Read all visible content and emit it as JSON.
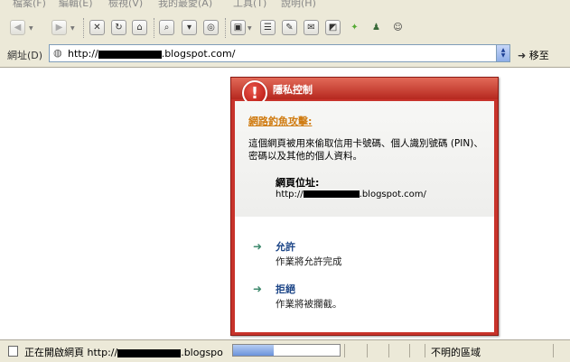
{
  "menu": [
    "檔案(F)",
    "編輯(E)",
    "檢視(V)",
    "我的最愛(A)",
    "工具(T)",
    "說明(H)"
  ],
  "address": {
    "label": "網址(D)",
    "url_prefix": "http://",
    "url_suffix": ".blogspot.com/",
    "go_label": "移至"
  },
  "dialog": {
    "title": "隱私控制",
    "heading": "網路釣魚攻擊:",
    "description": "這個網頁被用來偷取信用卡號碼、個人識別號碼 (PIN)、密碼以及其他的個人資料。",
    "url_label": "網頁位址:",
    "url_prefix": "http://",
    "url_suffix": ".blogspot.com/",
    "allow": {
      "title": "允許",
      "desc": "作業將允許完成"
    },
    "deny": {
      "title": "拒絕",
      "desc": "作業將被攔截。"
    }
  },
  "status": {
    "text_prefix": "正在開啟網頁 http://",
    "text_suffix": ".blogspo",
    "zone": "不明的區域",
    "progress": 0.38
  },
  "icons": [
    "back-icon",
    "forward-icon",
    "stop-icon",
    "refresh-icon",
    "home-icon",
    "search-icon",
    "favorites-icon",
    "history-icon",
    "view-icon",
    "print-icon",
    "edit-icon",
    "discuss-icon",
    "messenger-icon",
    "research-icon",
    "privacy-icon",
    "users-icon"
  ]
}
